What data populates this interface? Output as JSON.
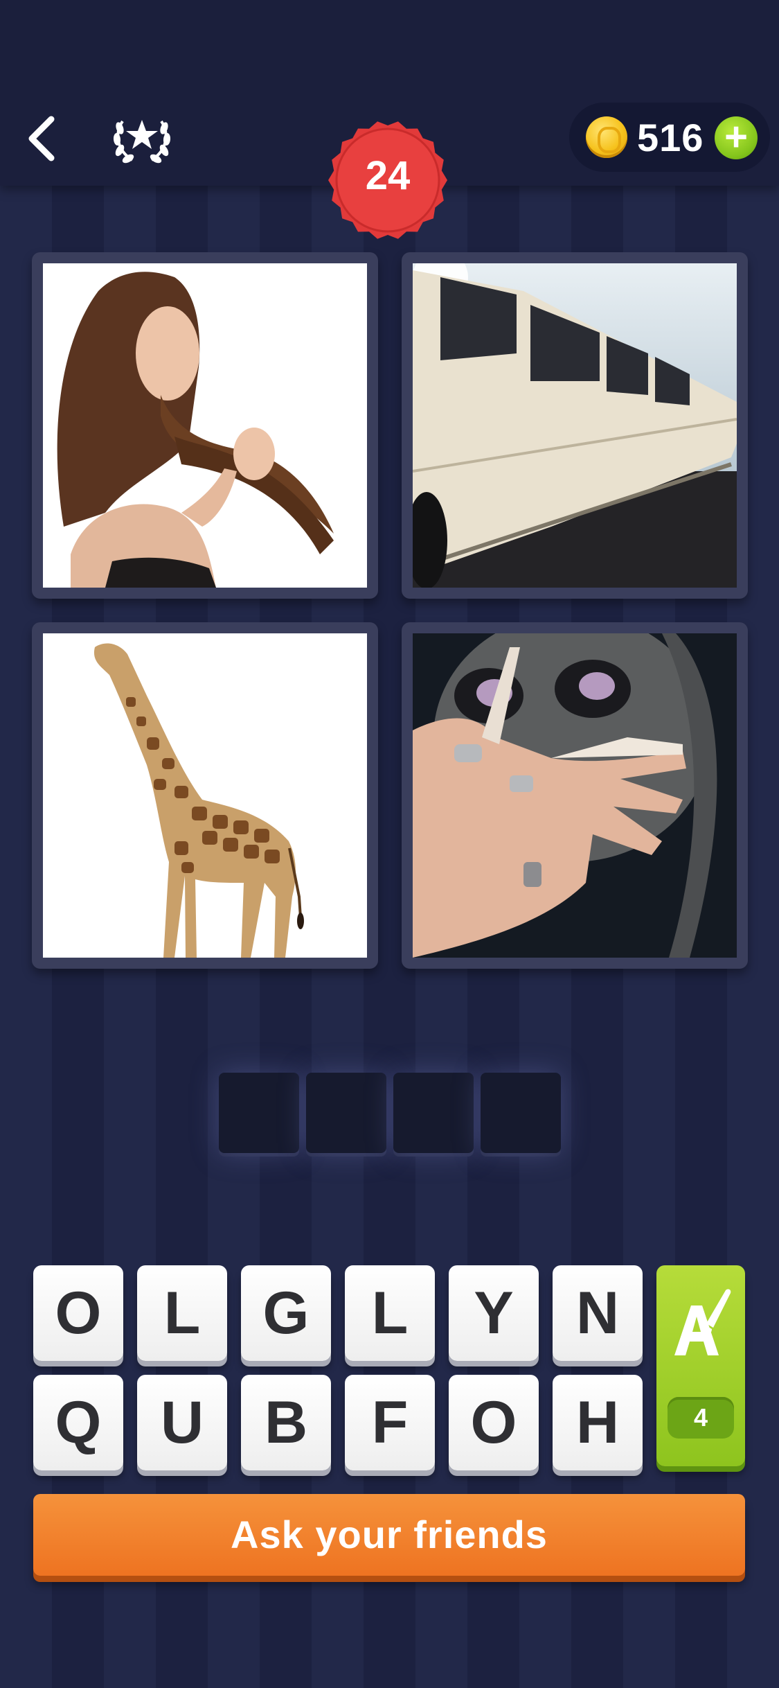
{
  "header": {
    "coins": "516",
    "level": "24"
  },
  "images": [
    {
      "name": "woman-hair-image"
    },
    {
      "name": "limousine-image"
    },
    {
      "name": "giraffe-image"
    },
    {
      "name": "long-nails-image"
    }
  ],
  "answer_slots": 4,
  "letters": {
    "row1": [
      "O",
      "L",
      "G",
      "L",
      "Y",
      "N"
    ],
    "row2": [
      "Q",
      "U",
      "B",
      "F",
      "O",
      "H"
    ]
  },
  "hint": {
    "icon": "paintbrush-letter-icon",
    "count": "4"
  },
  "ask_button": {
    "label": "Ask your friends"
  },
  "colors": {
    "background": "#1f2445",
    "badge_red": "#e23a3a",
    "hint_green": "#8ec41e",
    "ask_orange": "#ee7321",
    "coin_gold": "#f6c21c"
  }
}
